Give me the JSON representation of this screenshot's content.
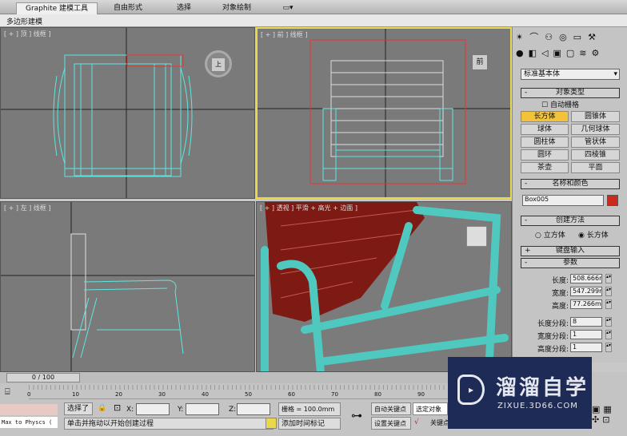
{
  "ribbon": {
    "tabs": [
      "Graphite 建模工具",
      "自由形式",
      "选择",
      "对象绘制"
    ],
    "dropdown_icon": "window-dropdown-icon"
  },
  "subbar": {
    "label": "多边形建模"
  },
  "viewports": {
    "top": "[ + ] 顶 ] 线框 ]",
    "front": "[ + ] 前 ] 线框 ]",
    "left": "[ + ] 左 ] 线框 ]",
    "perspective": "[ + ] 透视 ] 平滑 + 高光 + 边面 ]",
    "viewcube_top": "上",
    "viewcube_front": "前"
  },
  "panel": {
    "dropdown": "标准基本体",
    "object_type": {
      "title": "对象类型",
      "autogrid": "自动栅格",
      "buttons": [
        "长方体",
        "圆锥体",
        "球体",
        "几何球体",
        "圆柱体",
        "管状体",
        "圆环",
        "四棱锥",
        "茶壶",
        "平面"
      ],
      "selected": "长方体"
    },
    "name_color": {
      "title": "名称和颜色",
      "name": "Box005",
      "color": "#cc2a1c"
    },
    "creation": {
      "title": "创建方法",
      "options": [
        "立方体",
        "长方体"
      ],
      "selected": "长方体"
    },
    "keyboard": {
      "title": "键盘输入"
    },
    "params": {
      "title": "参数",
      "length_label": "长度:",
      "length": "508.666m",
      "width_label": "宽度:",
      "width": "547.299m",
      "height_label": "高度:",
      "height": "77.266mn",
      "lseg_label": "长度分段:",
      "lseg": "8",
      "wseg_label": "宽度分段:",
      "wseg": "1",
      "hseg_label": "高度分段:",
      "hseg": "1"
    }
  },
  "timeline": {
    "slider": "0 / 100",
    "ticks": [
      "0",
      "10",
      "20",
      "30",
      "40",
      "50",
      "60",
      "70",
      "80",
      "90"
    ]
  },
  "status": {
    "selected": "选择了",
    "x": "X:",
    "y": "Y:",
    "z": "Z:",
    "grid": "栅格 = 100.0mm",
    "prompt": "单击并拖动以开始创建过程",
    "add_marker": "添加时间标记",
    "auto_key": "自动关键点",
    "set_key": "设置关键点",
    "key_filter": "选定对象",
    "key_filters": "关键点",
    "script": "Max to Physcs ("
  },
  "watermark": {
    "title": "溜溜自学",
    "url": "ZIXUE.3D66.COM"
  },
  "colors": {
    "wire": "#5ee6e0",
    "selection": "#e8d84a",
    "highlight": "#f2c23a"
  }
}
